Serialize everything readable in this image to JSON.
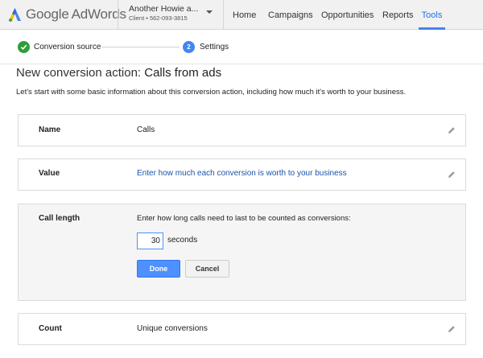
{
  "header": {
    "logo_google": "Google",
    "logo_product": "AdWords",
    "account_name": "Another Howie a...",
    "account_sub": "Client • 562-093-3815",
    "nav": [
      {
        "label": "Home"
      },
      {
        "label": "Campaigns"
      },
      {
        "label": "Opportunities"
      },
      {
        "label": "Reports"
      },
      {
        "label": "Tools",
        "active": true
      }
    ],
    "accent_color": "#4285f4"
  },
  "steps": {
    "step1_label": "Conversion source",
    "step2_number": "2",
    "step2_label": "Settings",
    "complete_color": "#2e9e38"
  },
  "page": {
    "title_prefix": "New conversion action: ",
    "title_name": "Calls from ads",
    "intro": "Let's start with some basic information about this conversion action, including how much it's worth to your business."
  },
  "fields": {
    "name": {
      "label": "Name",
      "value": "Calls"
    },
    "value": {
      "label": "Value",
      "value": "Enter how much each conversion is worth to your business"
    },
    "call_length": {
      "label": "Call length",
      "prompt": "Enter how long calls need to last to be counted as conversions:",
      "input_value": "30",
      "unit": "seconds",
      "done_label": "Done",
      "cancel_label": "Cancel"
    },
    "count": {
      "label": "Count",
      "value": "Unique conversions"
    }
  },
  "icons": {
    "logo": "adwords-logo-icon",
    "edit": "pencil-icon",
    "check": "check-icon",
    "caret": "caret-down-icon"
  }
}
